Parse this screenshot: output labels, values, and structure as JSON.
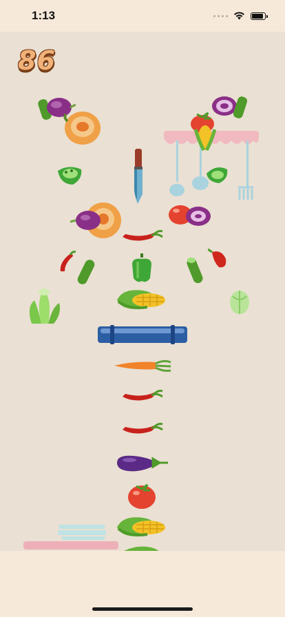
{
  "status_bar": {
    "time": "1:13",
    "battery_level": 0.9
  },
  "game": {
    "score": "86",
    "palette": {
      "background": "#eae0d3",
      "bottom_panel": "#f7e9da",
      "score_fill": "#f1b27a",
      "score_outline": "#7a3f18"
    },
    "falling_items": [
      "onion-and-cucumber",
      "pumpkin",
      "onion-and-cucumber",
      "tomato",
      "corn",
      "knife",
      "green-pepper-slice",
      "green-pepper-slice",
      "pumpkin",
      "onion",
      "tomato",
      "onion",
      "chili",
      "chili",
      "cucumber",
      "green-pepper",
      "cucumber",
      "red-chili",
      "bok-choy",
      "corn",
      "lettuce"
    ],
    "column_stack": [
      "blue-tray",
      "carrot",
      "chili",
      "chili",
      "eggplant",
      "tomato",
      "corn",
      "corn"
    ]
  }
}
